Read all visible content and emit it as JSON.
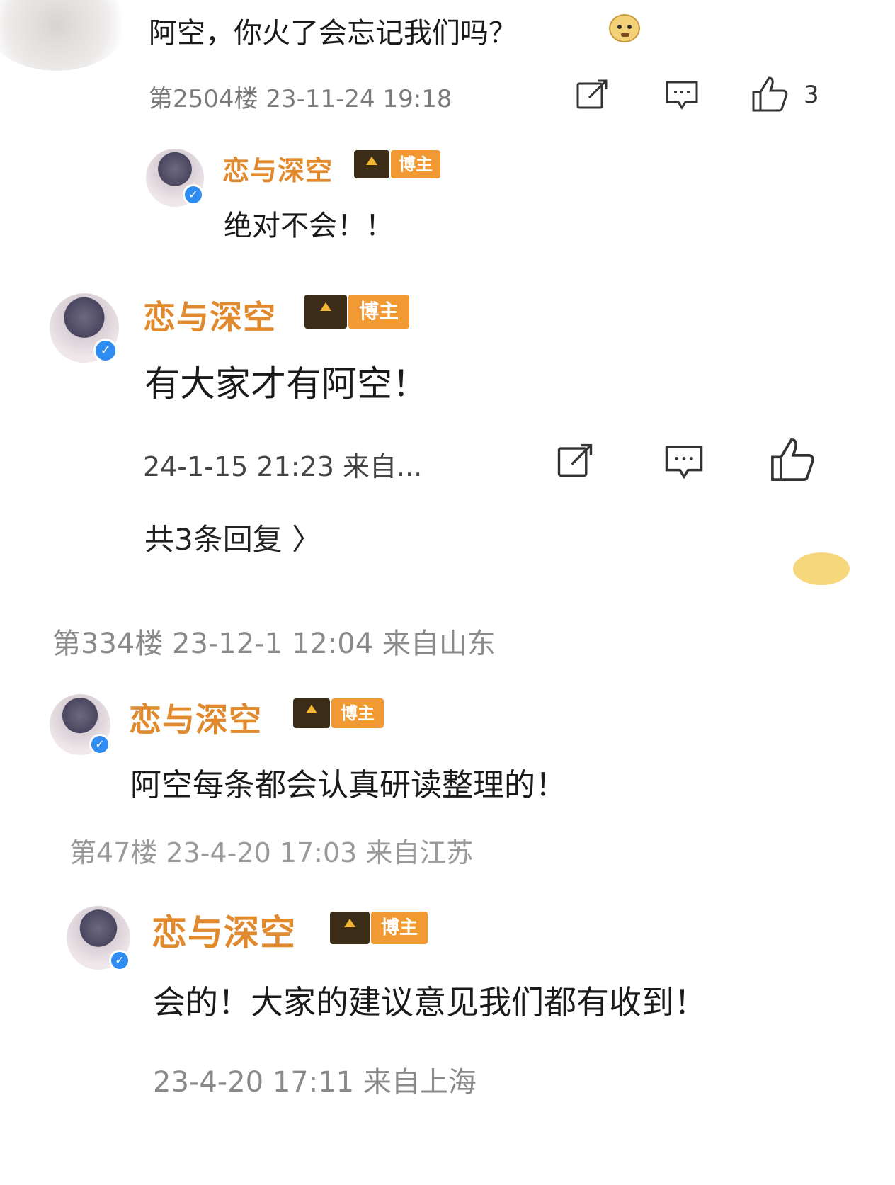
{
  "section1": {
    "comment_text": "阿空，你火了会忘记我们吗？",
    "emoji": "doge-emoji",
    "meta": "第2504楼 23-11-24 19:18",
    "like_count": "3",
    "reply": {
      "username": "恋与深空",
      "badge": "博主",
      "text": "绝对不会！！"
    }
  },
  "section2": {
    "username": "恋与深空",
    "badge": "博主",
    "text": "有大家才有阿空！",
    "meta": "24-1-15 21:23 来自...",
    "replies_link": "共3条回复 〉"
  },
  "section3": {
    "meta_top": "第334楼 23-12-1 12:04 来自山东",
    "username": "恋与深空",
    "badge": "博主",
    "text": "阿空每条都会认真研读整理的！"
  },
  "section4": {
    "meta_top": "第47楼 23-4-20 17:03 来自江苏",
    "username": "恋与深空",
    "badge": "博主",
    "text": "会的！大家的建议意见我们都有收到！",
    "meta": "23-4-20 17:11 来自上海"
  },
  "colors": {
    "username": "#e08a2d",
    "badge": "#f19a34",
    "verified": "#2f8cf0",
    "meta": "#7a7a7a"
  }
}
